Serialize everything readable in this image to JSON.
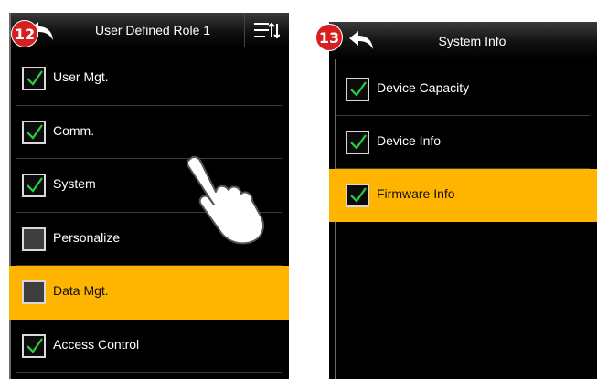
{
  "colors": {
    "highlight": "#ffb400",
    "check": "#2ecc40",
    "badge": "#d62020"
  },
  "left_screen": {
    "step_badge": "12",
    "title": "User Defined Role 1",
    "back_icon": "back-arrow-icon",
    "menu_icon": "sort-menu-icon",
    "items": [
      {
        "label": "User Mgt.",
        "checked": true,
        "highlighted": false
      },
      {
        "label": "Comm.",
        "checked": true,
        "highlighted": false
      },
      {
        "label": "System",
        "checked": true,
        "highlighted": false
      },
      {
        "label": "Personalize",
        "checked": false,
        "highlighted": false
      },
      {
        "label": "Data Mgt.",
        "checked": false,
        "highlighted": true
      },
      {
        "label": "Access Control",
        "checked": true,
        "highlighted": false
      }
    ]
  },
  "right_screen": {
    "step_badge": "13",
    "title": "System Info",
    "back_icon": "back-arrow-icon",
    "items": [
      {
        "label": "Device Capacity",
        "checked": true,
        "highlighted": false
      },
      {
        "label": "Device Info",
        "checked": true,
        "highlighted": false
      },
      {
        "label": "Firmware Info",
        "checked": true,
        "highlighted": true
      }
    ]
  },
  "overlay": {
    "pointer_icon": "hand-pointer-icon"
  }
}
